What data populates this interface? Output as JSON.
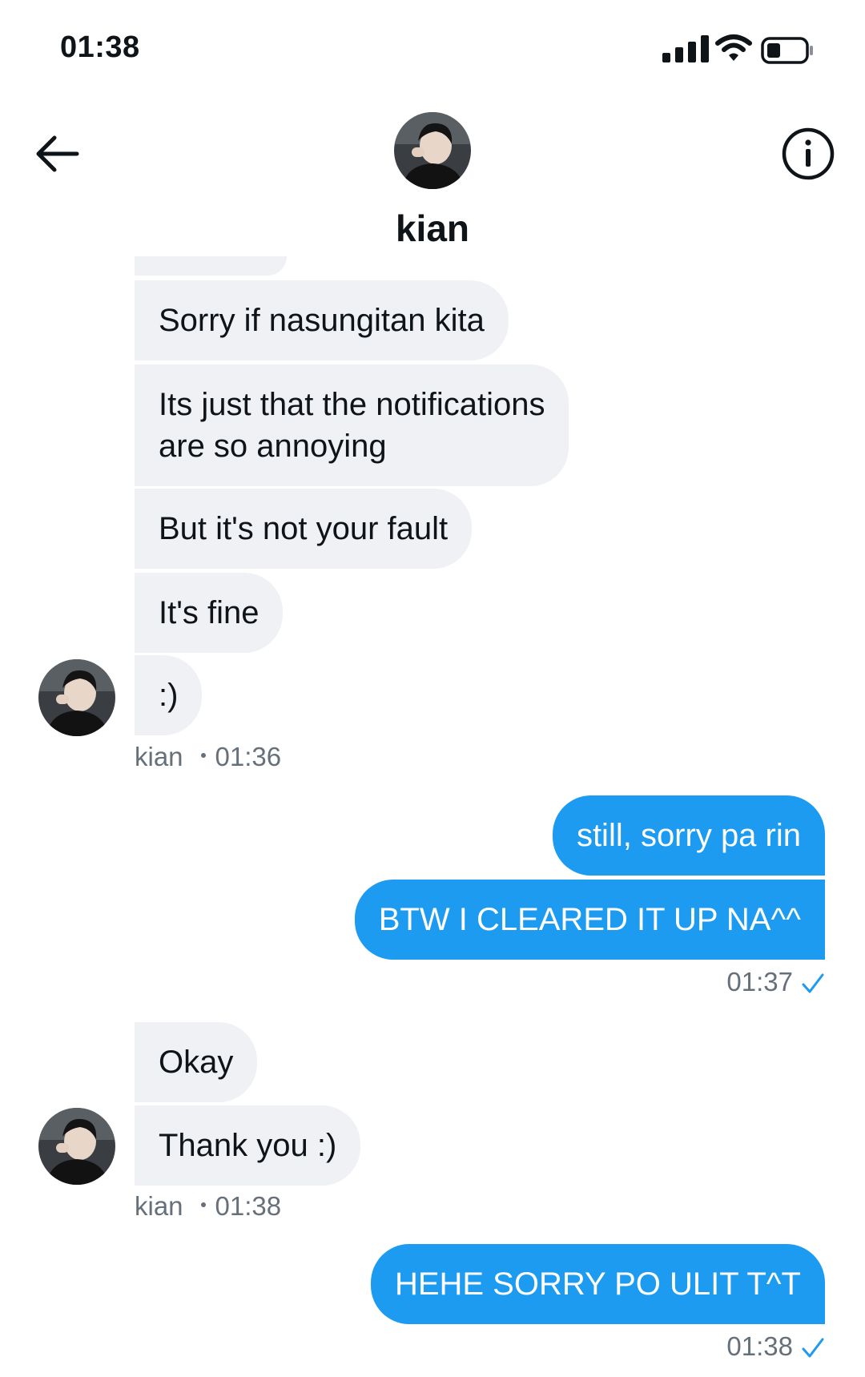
{
  "status_bar": {
    "time": "01:38"
  },
  "header": {
    "name": "kian"
  },
  "messages": [
    {
      "text": "Sorry if nasungitan kita"
    },
    {
      "text": "Its just that the notifications\nare so annoying"
    },
    {
      "text": "But it's not your fault"
    },
    {
      "text": "It's fine"
    },
    {
      "text": ":)"
    },
    {
      "text": "still, sorry pa rin"
    },
    {
      "text": "BTW I CLEARED IT UP NA^^"
    },
    {
      "text": "Okay"
    },
    {
      "text": "Thank you :)"
    },
    {
      "text": "HEHE SORRY PO ULIT T^T"
    }
  ],
  "meta": {
    "group1": {
      "sender": "kian",
      "time": "01:36"
    },
    "group2": {
      "time": "01:37"
    },
    "group3": {
      "sender": "kian",
      "time": "01:38"
    },
    "group4": {
      "time": "01:38"
    }
  },
  "colors": {
    "outgoing": "#1d9bf0",
    "incoming": "#eff1f4",
    "check": "#1d9bf0"
  },
  "icons": [
    "signal-icon",
    "wifi-icon",
    "battery-icon",
    "back-arrow-icon",
    "info-icon",
    "check-icon"
  ]
}
